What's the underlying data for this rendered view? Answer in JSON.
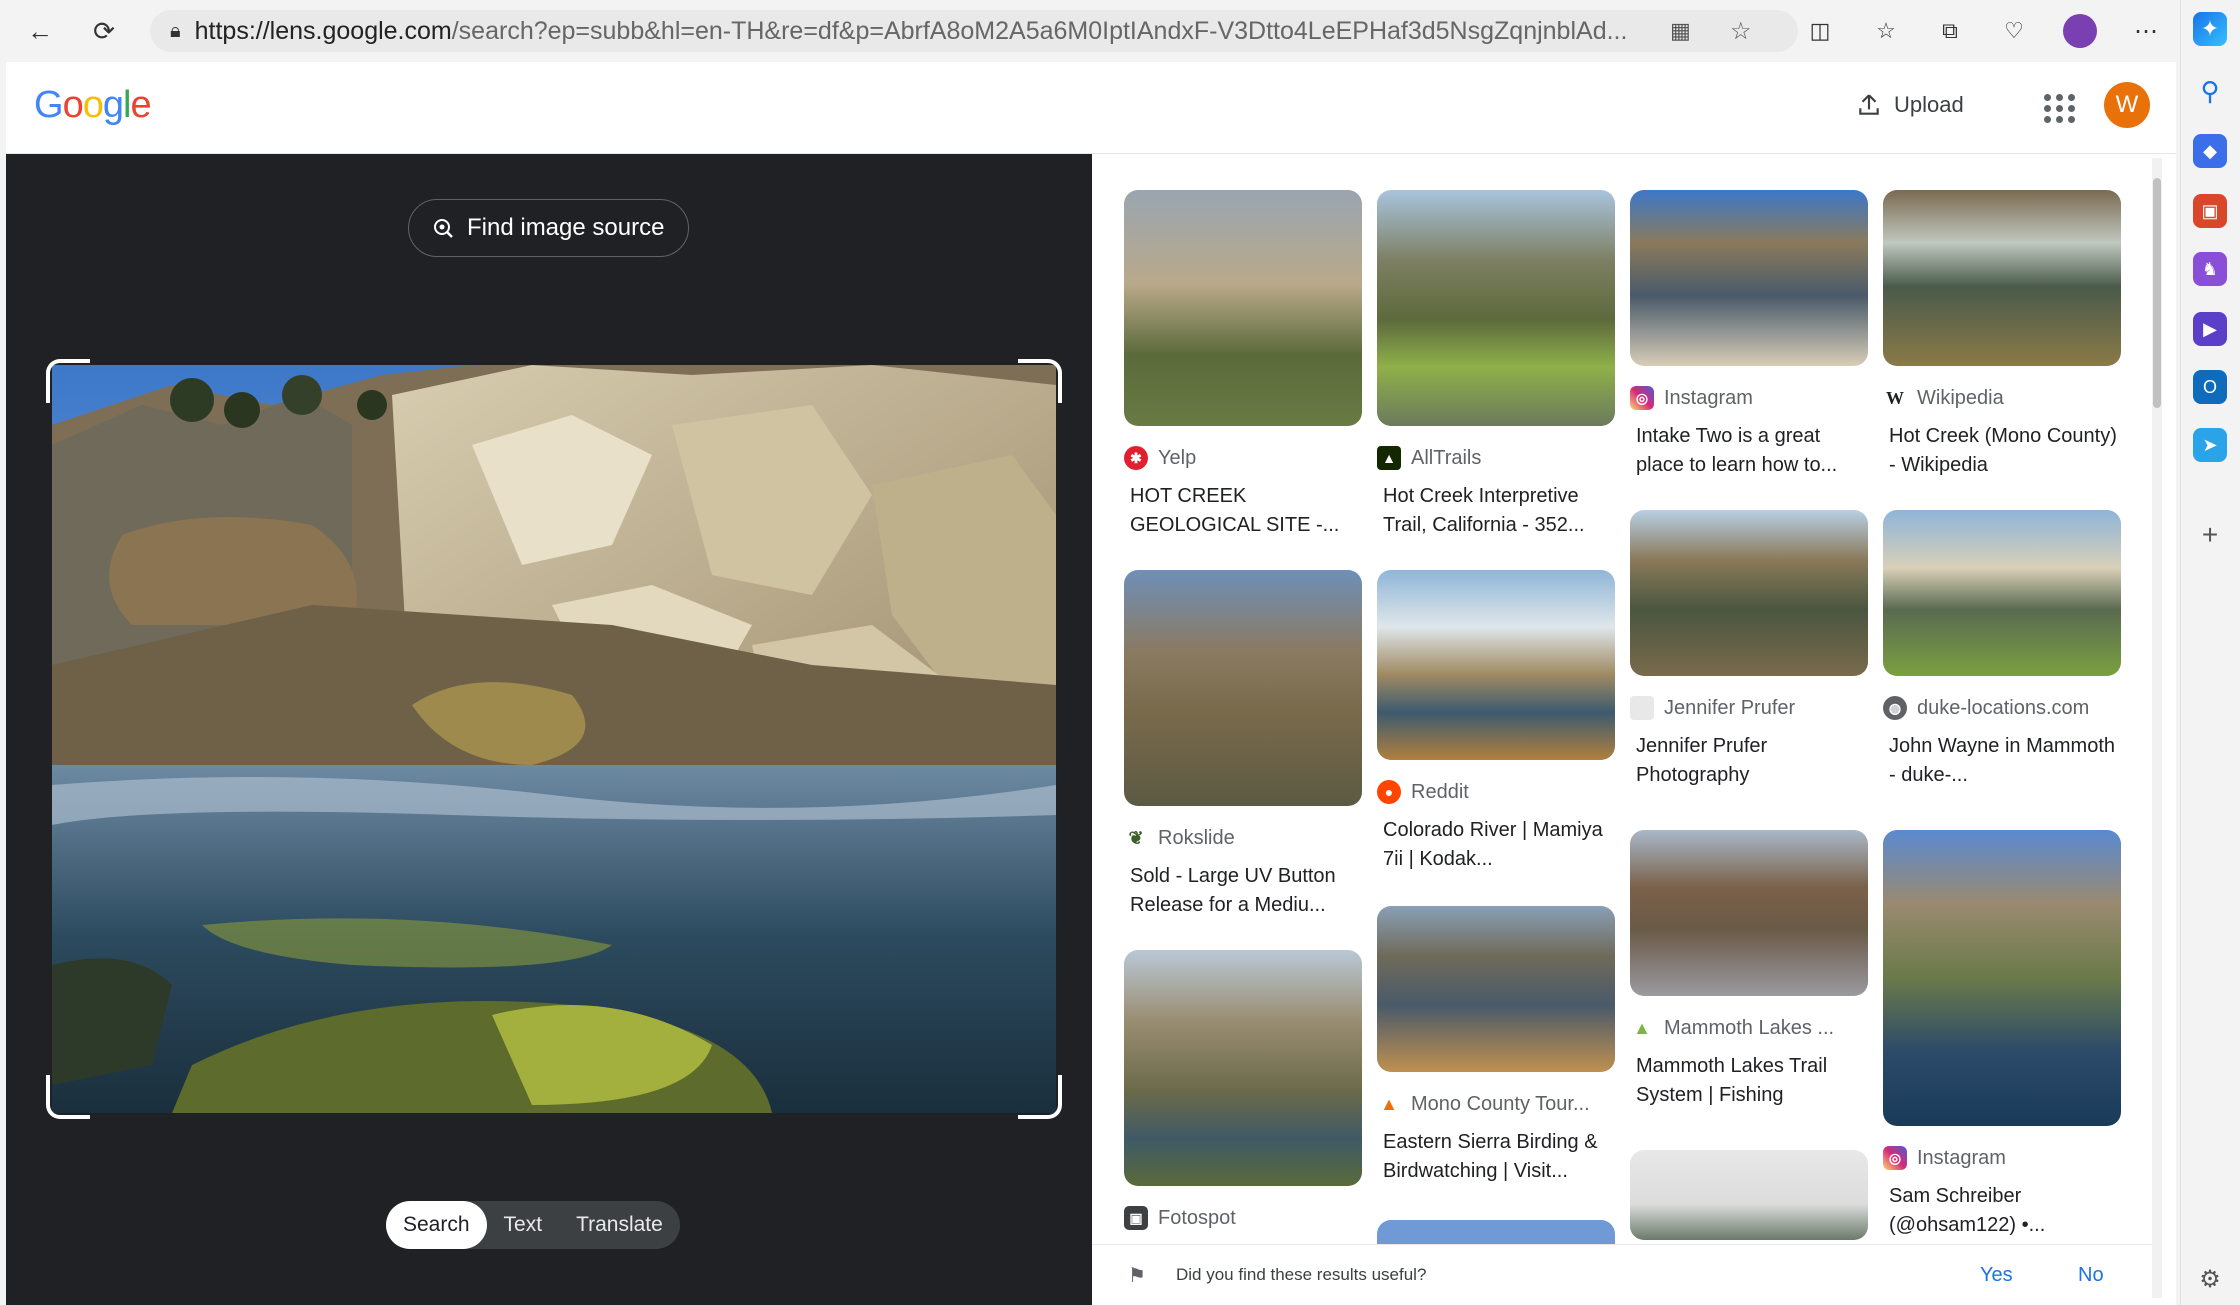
{
  "browser": {
    "url_host": "https://lens.google.com",
    "url_path": "/search?ep=subb&hl=en-TH&re=df&p=AbrfA8oM2A5a6M0IptIAndxF-V3Dtto4LeEPHaf3d5NsgZqnjnblAd..."
  },
  "header": {
    "logo": "Google",
    "upload_label": "Upload",
    "avatar_initial": "W"
  },
  "left_panel": {
    "find_source_label": "Find image source",
    "modes": [
      "Search",
      "Text",
      "Translate"
    ],
    "active_mode": "Search"
  },
  "results": [
    {
      "source": "Yelp",
      "title": "HOT CREEK GEOLOGICAL SITE -...",
      "icon_color": "#e0202e"
    },
    {
      "source": "AllTrails",
      "title": "Hot Creek Interpretive Trail, California - 352...",
      "icon_color": "#142800"
    },
    {
      "source": "Instagram",
      "title": "Intake Two is a great place to learn how to...",
      "icon_color": "#d6249f"
    },
    {
      "source": "Wikipedia",
      "title": "Hot Creek (Mono County) - Wikipedia",
      "icon_color": "#ffffff"
    },
    {
      "source": "Rokslide",
      "title": "Sold - Large UV Button Release for a Mediu...",
      "icon_color": "#3b5e2b"
    },
    {
      "source": "Reddit",
      "title": "Colorado River | Mamiya 7ii | Kodak...",
      "icon_color": "#ff4500"
    },
    {
      "source": "Jennifer Prufer",
      "title": "Jennifer Prufer Photography",
      "icon_color": "#e8e8e8"
    },
    {
      "source": "duke-locations.com",
      "title": "John Wayne in Mammoth - duke-...",
      "icon_color": "#5f6368"
    },
    {
      "source": "Mono County Tour...",
      "title": "Eastern Sierra Birding & Birdwatching | Visit...",
      "icon_color": "#e8710a"
    },
    {
      "source": "Mammoth Lakes ...",
      "title": "Mammoth Lakes Trail System | Fishing",
      "icon_color": "#7cb342"
    },
    {
      "source": "Fotospot",
      "title": "",
      "icon_color": "#3c4043"
    },
    {
      "source": "Instagram",
      "title": "Sam Schreiber (@ohsam122) •...",
      "icon_color": "#d6249f"
    }
  ],
  "feedback": {
    "question": "Did you find these results useful?",
    "yes": "Yes",
    "no": "No"
  }
}
